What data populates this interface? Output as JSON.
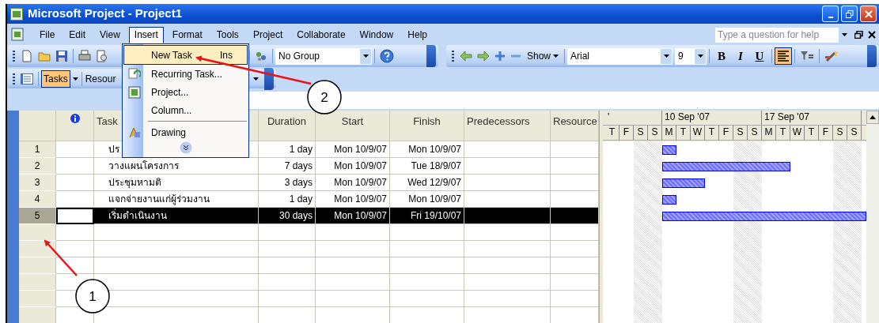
{
  "window": {
    "title": "Microsoft Project - Project1"
  },
  "menu_bar": [
    {
      "label": "File",
      "selected": false
    },
    {
      "label": "Edit",
      "selected": false
    },
    {
      "label": "View",
      "selected": false
    },
    {
      "label": "Insert",
      "selected": true
    },
    {
      "label": "Format",
      "selected": false
    },
    {
      "label": "Tools",
      "selected": false
    },
    {
      "label": "Project",
      "selected": false
    },
    {
      "label": "Collaborate",
      "selected": false
    },
    {
      "label": "Window",
      "selected": false
    },
    {
      "label": "Help",
      "selected": false
    }
  ],
  "help_box": {
    "placeholder": "Type a question for help"
  },
  "insert_menu": [
    {
      "label": "New Task",
      "shortcut": "Ins",
      "highlighted": true,
      "separator_before": false
    },
    {
      "label": "Recurring Task...",
      "highlighted": false,
      "separator_before": false
    },
    {
      "label": "Project...",
      "highlighted": false,
      "separator_before": false
    },
    {
      "label": "Column...",
      "highlighted": false,
      "separator_before": false
    },
    {
      "label": "Drawing",
      "highlighted": false,
      "separator_before": true
    }
  ],
  "standard_toolbar": {
    "group_box": "No Group",
    "show_button": "Show"
  },
  "formatting_toolbar": {
    "font_box": "Arial",
    "size_box": "9",
    "buttons": [
      {
        "kind": "bold",
        "label": "B",
        "on": false
      },
      {
        "kind": "italic",
        "label": "I",
        "on": false
      },
      {
        "kind": "underline",
        "label": "U",
        "on": false
      },
      {
        "kind": "align-left",
        "on": true
      }
    ]
  },
  "view_bar": [
    {
      "label": "Tasks",
      "selected": true
    },
    {
      "label": "Resour",
      "selected": false
    }
  ],
  "table": {
    "columns": [
      "Task",
      "Duration",
      "Start",
      "Finish",
      "Predecessors",
      "Resource"
    ],
    "rows": [
      {
        "id": "1",
        "task": "ปร",
        "duration": "1 day",
        "start": "Mon 10/9/07",
        "finish": "Mon 10/9/07",
        "selected": false
      },
      {
        "id": "2",
        "task": "วางแผนโครงการ",
        "duration": "7 days",
        "start": "Mon 10/9/07",
        "finish": "Tue 18/9/07",
        "selected": false
      },
      {
        "id": "3",
        "task": "ประชุมหามติ",
        "duration": "3 days",
        "start": "Mon 10/9/07",
        "finish": "Wed 12/9/07",
        "selected": false
      },
      {
        "id": "4",
        "task": "แจกจ่ายงานแก่ผู้ร่วมงาน",
        "duration": "1 day",
        "start": "Mon 10/9/07",
        "finish": "Mon 10/9/07",
        "selected": false
      },
      {
        "id": "5",
        "task": "เริ่มดำเนินงาน",
        "duration": "30 days",
        "start": "Mon 10/9/07",
        "finish": "Fri 19/10/07",
        "selected": true
      }
    ]
  },
  "gantt": {
    "weeks": [
      "'",
      "10 Sep '07",
      "17 Sep '07"
    ],
    "days": [
      "T",
      "F",
      "S",
      "S",
      "M",
      "T",
      "W",
      "T",
      "F",
      "S",
      "S",
      "M",
      "T",
      "W",
      "T",
      "F",
      "S",
      "S"
    ]
  },
  "callouts": [
    {
      "label": "2"
    },
    {
      "label": "1"
    }
  ]
}
